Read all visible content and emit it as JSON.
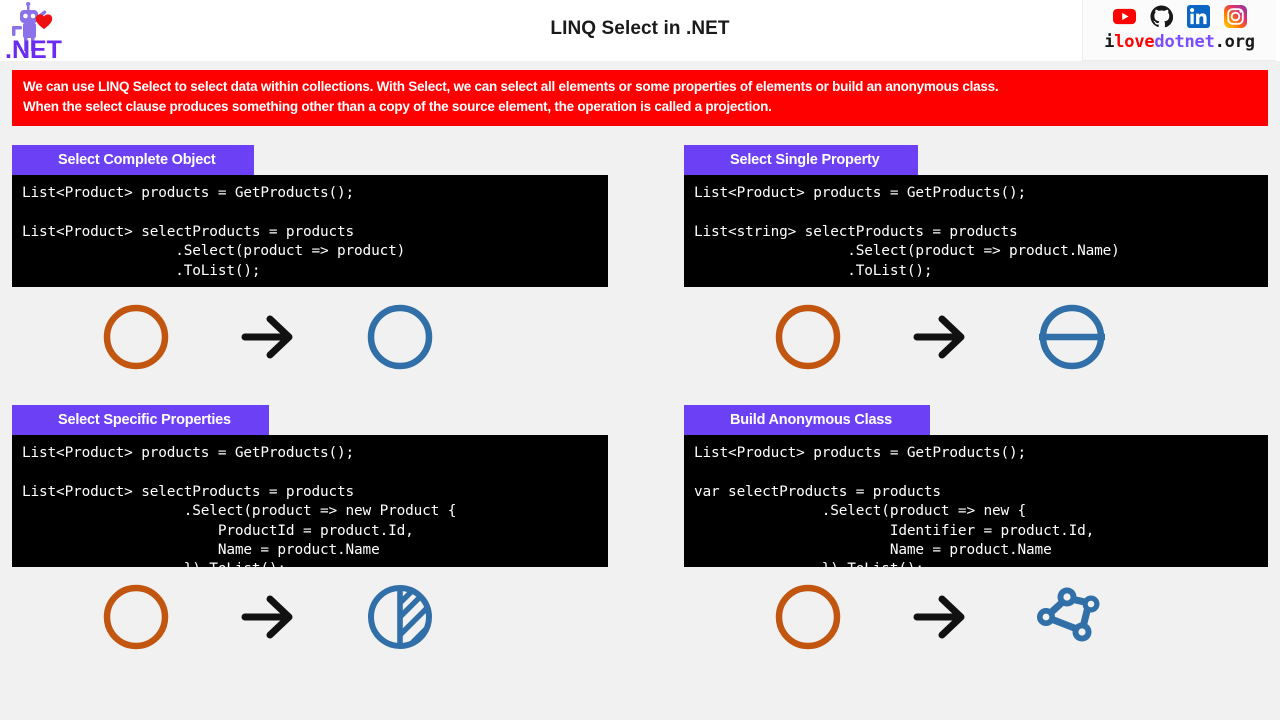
{
  "header": {
    "title": "LINQ Select in .NET",
    "logo": {
      "name": "dotnet-bot-heart-logo",
      "text": ".NET"
    },
    "brand": {
      "prefix": "i",
      "love": "love",
      "dotnet": "dotnet",
      "suffix": ".org"
    },
    "social": [
      {
        "name": "youtube-icon",
        "label": "YouTube",
        "color": "#ff0000"
      },
      {
        "name": "github-icon",
        "label": "GitHub",
        "color": "#181717"
      },
      {
        "name": "linkedin-icon",
        "label": "LinkedIn",
        "color": "#0a66c2"
      },
      {
        "name": "instagram-icon",
        "label": "Instagram",
        "color": "#e1306c"
      }
    ]
  },
  "banner": {
    "background": "#ff0000",
    "line1": "We can use LINQ Select to select data within collections. With Select, we can select all elements or some properties of elements or build an anonymous class.",
    "line2": "When the select clause produces something other than a copy of the source element, the operation is called a projection."
  },
  "panels": [
    {
      "tag": "Select Complete Object",
      "code": "List<Product> products = GetProducts();\n\nList<Product> selectProducts = products\n                  .Select(product => product)\n                  .ToList();",
      "illustration": {
        "source": "circle-outline",
        "source_color": "#c2550f",
        "result": "circle-outline",
        "result_color": "#316fa8"
      }
    },
    {
      "tag": "Select Single Property",
      "code": "List<Product> products = GetProducts();\n\nList<string> selectProducts = products\n                  .Select(product => product.Name)\n                  .ToList();",
      "illustration": {
        "source": "circle-outline",
        "source_color": "#c2550f",
        "result": "circle-split-horizontal",
        "result_color": "#316fa8"
      }
    },
    {
      "tag": "Select Specific Properties",
      "code": "List<Product> products = GetProducts();\n\nList<Product> selectProducts = products\n                   .Select(product => new Product {\n                       ProductId = product.Id,\n                       Name = product.Name\n                   }).ToList();",
      "illustration": {
        "source": "circle-outline",
        "source_color": "#c2550f",
        "result": "circle-half-hatched",
        "result_color": "#316fa8"
      }
    },
    {
      "tag": "Build Anonymous Class",
      "code": "List<Product> products = GetProducts();\n\nvar selectProducts = products\n               .Select(product => new {\n                       Identifier = product.Id,\n                       Name = product.Name\n               }).ToList();",
      "illustration": {
        "source": "circle-outline",
        "source_color": "#c2550f",
        "result": "node-graph",
        "result_color": "#316fa8"
      }
    }
  ],
  "colors": {
    "accent_purple": "#6c41f5",
    "banner_red": "#ff0000",
    "code_bg": "#000000",
    "page_bg": "#f1f1f1",
    "orange": "#c2550f",
    "blue": "#316fa8"
  }
}
